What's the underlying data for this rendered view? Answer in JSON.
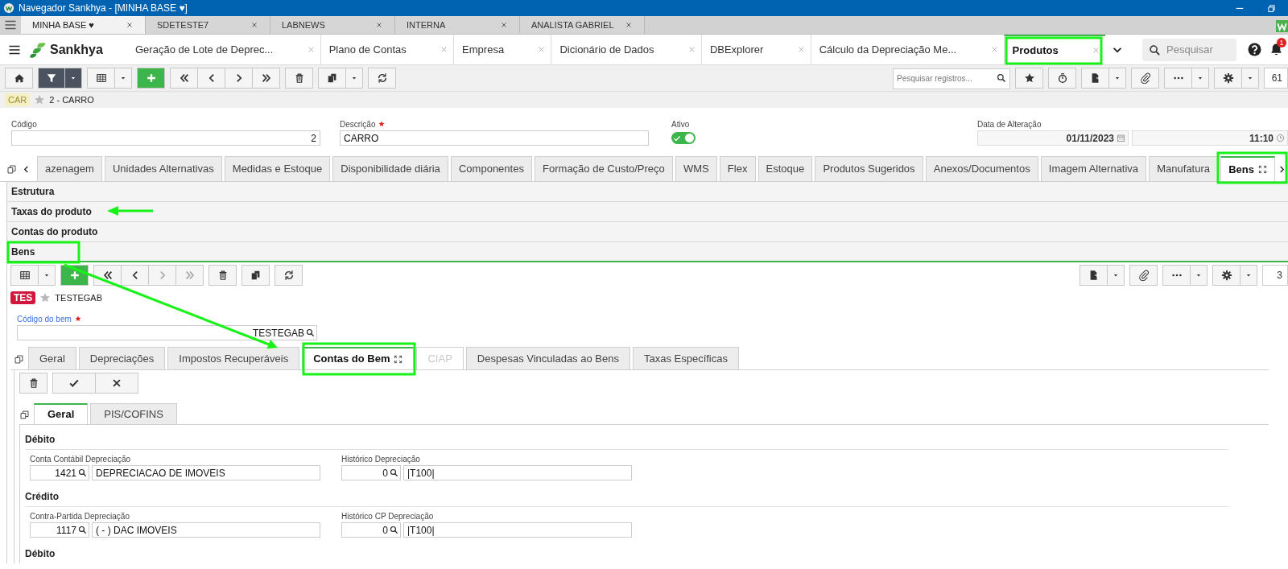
{
  "window": {
    "title": "Navegador Sankhya - [MINHA BASE ♥]"
  },
  "browser_tabs": [
    {
      "label": "MINHA BASE ♥",
      "selected": true
    },
    {
      "label": "SDETESTE7",
      "selected": false
    },
    {
      "label": "LABNEWS",
      "selected": false
    },
    {
      "label": "INTERNA",
      "selected": false
    },
    {
      "label": "ANALISTA GABRIEL",
      "selected": false
    }
  ],
  "header": {
    "brand": "Sankhya",
    "tabs": [
      {
        "label": "Geração de Lote de Deprec...",
        "selected": false
      },
      {
        "label": "Plano de Contas",
        "selected": false
      },
      {
        "label": "Empresa",
        "selected": false
      },
      {
        "label": "Dicionário de Dados",
        "selected": false
      },
      {
        "label": "DBExplorer",
        "selected": false
      },
      {
        "label": "Cálculo da Depreciação Me...",
        "selected": false
      },
      {
        "label": "Produtos",
        "selected": true
      }
    ],
    "search": {
      "placeholder": "Pesquisar"
    },
    "notifications": "1"
  },
  "toolbar": {
    "search": {
      "placeholder": "Pesquisar registros..."
    },
    "count": "61"
  },
  "record": {
    "badge": "CAR",
    "title": "2 - CARRO"
  },
  "fields": [
    {
      "label": "Código",
      "value": "2",
      "required": false,
      "kind": "number"
    },
    {
      "label": "Descrição",
      "value": "CARRO",
      "required": true,
      "kind": "text"
    }
  ],
  "active": {
    "label": "Ativo",
    "on": true
  },
  "changed": {
    "label": "Data de Alteração",
    "date": "01/11/2023",
    "time": "11:10"
  },
  "tabs": [
    {
      "label": "azenagem",
      "selected": false
    },
    {
      "label": "Unidades Alternativas",
      "selected": false
    },
    {
      "label": "Medidas e Estoque",
      "selected": false
    },
    {
      "label": "Disponibilidade diária",
      "selected": false
    },
    {
      "label": "Componentes",
      "selected": false
    },
    {
      "label": "Formação de Custo/Preço",
      "selected": false
    },
    {
      "label": "WMS",
      "selected": false
    },
    {
      "label": "Flex",
      "selected": false
    },
    {
      "label": "Estoque",
      "selected": false
    },
    {
      "label": "Produtos Sugeridos",
      "selected": false
    },
    {
      "label": "Anexos/Documentos",
      "selected": false
    },
    {
      "label": "Imagem Alternativa",
      "selected": false
    },
    {
      "label": "Manufatura",
      "selected": false
    },
    {
      "label": "Bens",
      "selected": true
    }
  ],
  "sections": [
    {
      "label": "Estrutura",
      "expanded": false
    },
    {
      "label": "Taxas do produto",
      "expanded": false
    },
    {
      "label": "Contas do produto",
      "expanded": false
    },
    {
      "label": "Bens",
      "expanded": true
    }
  ],
  "detail": {
    "toolbar": {
      "count": "3"
    },
    "record": {
      "badge": "TES",
      "title": "TESTEGAB"
    },
    "lookup": {
      "label": "Código do bem",
      "required": true,
      "value": "TESTEGAB"
    },
    "tabs": [
      {
        "label": "Geral",
        "selected": false,
        "disabled": false
      },
      {
        "label": "Depreciações",
        "selected": false,
        "disabled": false
      },
      {
        "label": "Impostos Recuperáveis",
        "selected": false,
        "disabled": false
      },
      {
        "label": "Contas do Bem",
        "selected": true,
        "disabled": false
      },
      {
        "label": "CIAP",
        "selected": false,
        "disabled": true
      },
      {
        "label": "Despesas Vinculadas ao Bens",
        "selected": false,
        "disabled": false
      },
      {
        "label": "Taxas Específicas",
        "selected": false,
        "disabled": false
      }
    ],
    "inner_tabs": [
      {
        "label": "Geral",
        "selected": true
      },
      {
        "label": "PIS/COFINS",
        "selected": false
      }
    ],
    "groups": [
      {
        "title": "Débito",
        "fields": [
          {
            "label": "Conta Contábil Depreciação",
            "code": "1421",
            "description": "DEPRECIACAO DE IMOVEIS"
          },
          {
            "label": "Histórico Depreciação",
            "code": "0",
            "description": "|T100|"
          }
        ]
      },
      {
        "title": "Crédito",
        "fields": [
          {
            "label": "Contra-Partida Depreciação",
            "code": "1117",
            "description": "( - ) DAC IMOVEIS"
          },
          {
            "label": "Histórico CP Depreciação",
            "code": "0",
            "description": "|T100|"
          }
        ]
      },
      {
        "title": "Débito"
      }
    ]
  }
}
